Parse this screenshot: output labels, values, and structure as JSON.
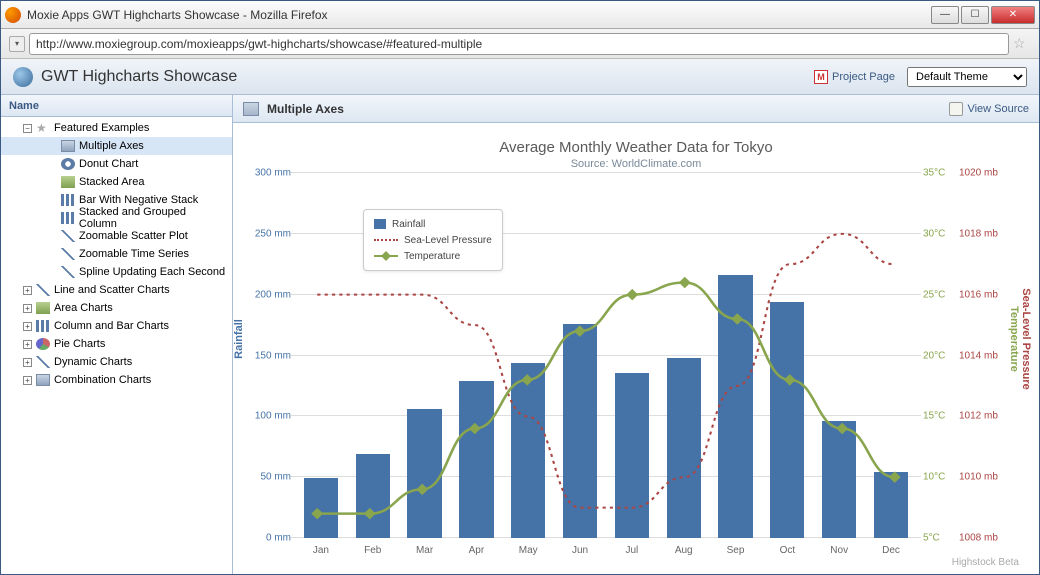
{
  "window": {
    "title": "Moxie Apps GWT Highcharts Showcase - Mozilla Firefox"
  },
  "url": "http://www.moxiegroup.com/moxieapps/gwt-highcharts/showcase/#featured-multiple",
  "app": {
    "title": "GWT Highcharts Showcase",
    "project_link": "Project Page",
    "theme_select": "Default Theme"
  },
  "sidebar": {
    "header": "Name",
    "featured": {
      "label": "Featured Examples",
      "items": [
        "Multiple Axes",
        "Donut Chart",
        "Stacked Area",
        "Bar With Negative Stack",
        "Stacked and Grouped Column",
        "Zoomable Scatter Plot",
        "Zoomable Time Series",
        "Spline Updating Each Second"
      ]
    },
    "groups": [
      "Line and Scatter Charts",
      "Area Charts",
      "Column and Bar Charts",
      "Pie Charts",
      "Dynamic Charts",
      "Combination Charts"
    ]
  },
  "content": {
    "title": "Multiple Axes",
    "view_source": "View Source",
    "credit": "Highstock Beta"
  },
  "chart": {
    "title": "Average Monthly Weather Data for Tokyo",
    "subtitle": "Source: WorldClimate.com",
    "legend": {
      "rainfall": "Rainfall",
      "pressure": "Sea-Level Pressure",
      "temp": "Temperature"
    },
    "axes": {
      "rainfall_label": "Rainfall",
      "temp_label": "Temperature",
      "pressure_label": "Sea-Level Pressure",
      "rainfall_ticks": [
        "0 mm",
        "50 mm",
        "100 mm",
        "150 mm",
        "200 mm",
        "250 mm",
        "300 mm"
      ],
      "temp_ticks": [
        "5°C",
        "10°C",
        "15°C",
        "20°C",
        "25°C",
        "30°C",
        "35°C"
      ],
      "pressure_ticks": [
        "1008 mb",
        "1010 mb",
        "1012 mb",
        "1014 mb",
        "1016 mb",
        "1018 mb",
        "1020 mb"
      ]
    }
  },
  "chart_data": {
    "type": "combo",
    "categories": [
      "Jan",
      "Feb",
      "Mar",
      "Apr",
      "May",
      "Jun",
      "Jul",
      "Aug",
      "Sep",
      "Oct",
      "Nov",
      "Dec"
    ],
    "series": [
      {
        "name": "Rainfall",
        "type": "bar",
        "unit": "mm",
        "axis": "left",
        "values": [
          49,
          69,
          106,
          129,
          144,
          176,
          136,
          148,
          216,
          194,
          96,
          54
        ]
      },
      {
        "name": "Temperature",
        "type": "spline",
        "unit": "°C",
        "axis": "right1",
        "values": [
          7,
          7,
          9,
          14,
          18,
          22,
          25,
          26,
          23,
          18,
          14,
          10
        ]
      },
      {
        "name": "Sea-Level Pressure",
        "type": "spline-dotted",
        "unit": "mb",
        "axis": "right2",
        "values": [
          1016,
          1016,
          1016,
          1015,
          1012,
          1009,
          1009,
          1010,
          1013,
          1017,
          1018,
          1017
        ]
      }
    ],
    "ylim_rainfall": [
      0,
      300
    ],
    "ylim_temp": [
      5,
      35
    ],
    "ylim_pressure": [
      1008,
      1020
    ]
  }
}
